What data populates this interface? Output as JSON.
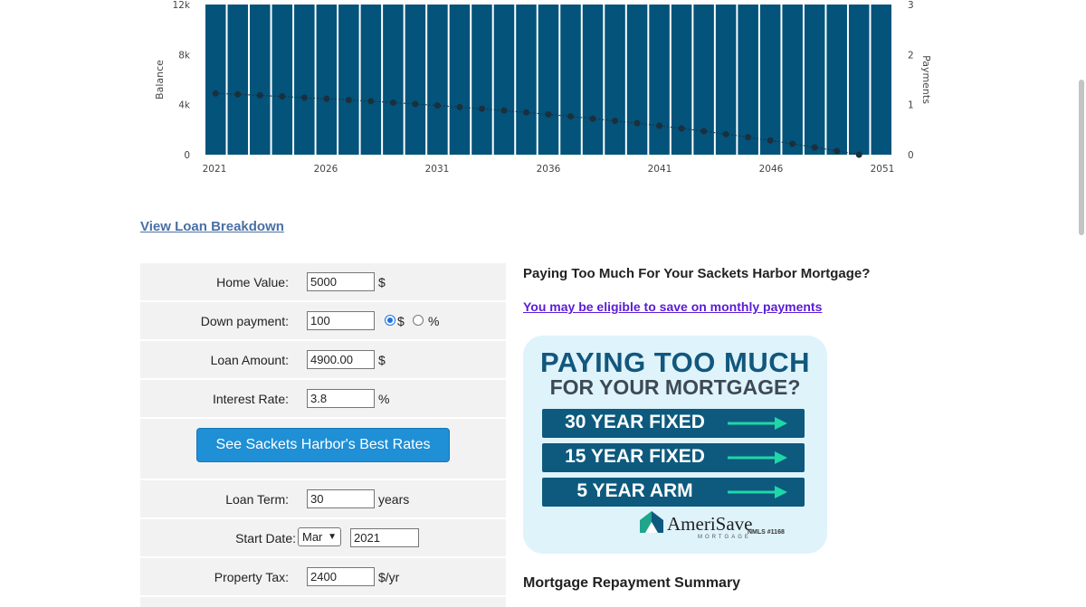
{
  "chart_data": {
    "type": "bar",
    "x_ticks": [
      "2021",
      "2026",
      "2031",
      "2036",
      "2041",
      "2046",
      "2051"
    ],
    "y_left_ticks": [
      "0",
      "4k",
      "8k",
      "12k"
    ],
    "y_right_ticks": [
      "0",
      "1",
      "2",
      "3"
    ],
    "ylabel_left": "Balance",
    "ylabel_right": "Payments",
    "ylim_left": [
      0,
      12000
    ],
    "ylim_right": [
      0,
      3
    ],
    "xlim": [
      2021,
      2051
    ],
    "bar_series": {
      "x": [
        2021,
        2022,
        2023,
        2024,
        2025,
        2026,
        2027,
        2028,
        2029,
        2030,
        2031,
        2032,
        2033,
        2034,
        2035,
        2036,
        2037,
        2038,
        2039,
        2040,
        2041,
        2042,
        2043,
        2044,
        2045,
        2046,
        2047,
        2048,
        2049,
        2050,
        2051
      ],
      "value": 3,
      "color": "#03537a"
    },
    "line_series": {
      "x": [
        2021,
        2022,
        2023,
        2024,
        2025,
        2026,
        2027,
        2028,
        2029,
        2030,
        2031,
        2032,
        2033,
        2034,
        2035,
        2036,
        2037,
        2038,
        2039,
        2040,
        2041,
        2042,
        2043,
        2044,
        2045,
        2046,
        2047,
        2048,
        2049,
        2050
      ],
      "values": [
        4900,
        4820,
        4740,
        4650,
        4560,
        4470,
        4370,
        4270,
        4160,
        4050,
        3930,
        3800,
        3670,
        3530,
        3380,
        3220,
        3060,
        2880,
        2700,
        2510,
        2310,
        2100,
        1880,
        1640,
        1400,
        1140,
        870,
        590,
        300,
        0
      ],
      "color": "#1c2f3c"
    }
  },
  "links": {
    "view_breakdown": "View Loan Breakdown",
    "eligible": "You may be eligible to save on monthly payments"
  },
  "form": {
    "home_value": {
      "label": "Home Value:",
      "value": "5000",
      "unit": "$"
    },
    "down_payment": {
      "label": "Down payment:",
      "value": "100",
      "opt_dollar": "$",
      "opt_percent": "%"
    },
    "loan_amount": {
      "label": "Loan Amount:",
      "value": "4900.00",
      "unit": "$"
    },
    "interest_rate": {
      "label": "Interest Rate:",
      "value": "3.8",
      "unit": "%"
    },
    "rates_button": "See Sackets Harbor's Best Rates",
    "loan_term": {
      "label": "Loan Term:",
      "value": "30",
      "unit": "years"
    },
    "start_date": {
      "label": "Start Date:",
      "month": "Mar",
      "year": "2021"
    },
    "property_tax": {
      "label": "Property Tax:",
      "value": "2400",
      "unit": "$/yr"
    }
  },
  "sidebar": {
    "title": "Paying Too Much For Your Sackets Harbor Mortgage?",
    "summary_title": "Mortgage Repayment Summary"
  },
  "ad": {
    "headline1": "PAYING TOO MUCH",
    "headline2": "FOR YOUR MORTGAGE?",
    "options": [
      "30 YEAR FIXED",
      "15 YEAR FIXED",
      "5 YEAR ARM"
    ],
    "brand": "AmeriSave",
    "brand_sub": "MORTGAGE",
    "nmls": "NMLS #1168",
    "accent": "#1fd6a8"
  }
}
